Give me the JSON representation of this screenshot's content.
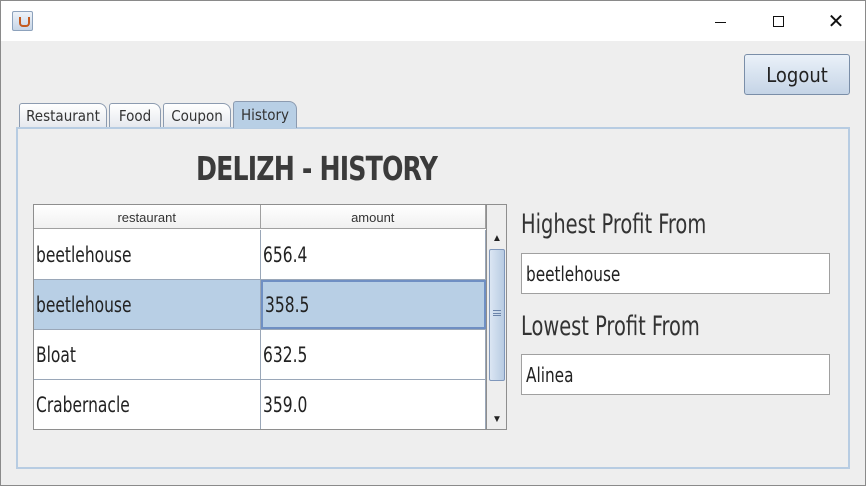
{
  "window": {
    "controls": {
      "minimize": "minimize-icon",
      "maximize": "maximize-icon",
      "close": "close-icon",
      "close_glyph": "✕"
    }
  },
  "header": {
    "logout_label": "Logout"
  },
  "tabs": [
    {
      "label": "Restaurant",
      "active": false
    },
    {
      "label": "Food",
      "active": false
    },
    {
      "label": "Coupon",
      "active": false
    },
    {
      "label": "History",
      "active": true
    }
  ],
  "history": {
    "title": "DELIZH - HISTORY",
    "table": {
      "columns": [
        "restaurant",
        "amount"
      ],
      "rows": [
        {
          "restaurant": "beetlehouse",
          "amount": "656.4",
          "selected": false
        },
        {
          "restaurant": "beetlehouse",
          "amount": "358.5",
          "selected": true
        },
        {
          "restaurant": "Bloat",
          "amount": "632.5",
          "selected": false
        },
        {
          "restaurant": "Crabernacle",
          "amount": "359.0",
          "selected": false
        }
      ]
    },
    "highest_profit_label": "Highest Profit From",
    "highest_profit_value": "beetlehouse",
    "lowest_profit_label": "Lowest Profit From",
    "lowest_profit_value": "Alinea"
  },
  "colors": {
    "tab_active": "#b8cfe5",
    "selection": "#b8cfe5",
    "panel_border": "#b7cce2"
  }
}
